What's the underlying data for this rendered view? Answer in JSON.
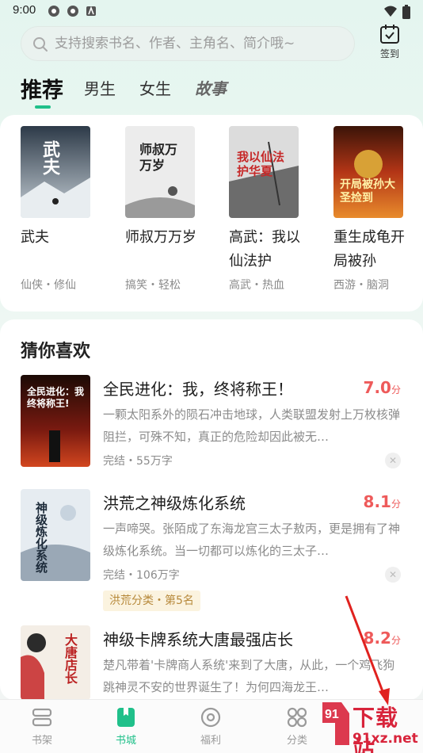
{
  "status_bar": {
    "time": "9:00"
  },
  "search": {
    "placeholder": "支持搜索书名、作者、主角名、简介哦~"
  },
  "signin": {
    "label": "签到"
  },
  "tabs": [
    {
      "label": "推荐"
    },
    {
      "label": "男生"
    },
    {
      "label": "女生"
    },
    {
      "label": "故事"
    }
  ],
  "recommend": {
    "books": [
      {
        "title": "武夫",
        "tags": "仙侠・修仙",
        "cover_text": "武夫",
        "cover_bg": "#cfd5da"
      },
      {
        "title": "师叔万万岁",
        "tags": "搞笑・轻松",
        "cover_text": "师叔万万岁",
        "cover_bg": "#e8e8e8"
      },
      {
        "title": "高武：我以仙法护",
        "tags": "高武・热血",
        "cover_text": "我以仙法护华夏",
        "cover_bg": "#d9d9d9"
      },
      {
        "title": "重生成龟开局被孙",
        "tags": "西游・脑洞",
        "cover_text": "开局被孙大圣捡到",
        "cover_bg": "#8a2b17"
      }
    ]
  },
  "guess": {
    "title": "猜你喜欢",
    "items": [
      {
        "name": "全民进化：我，终将称王！",
        "score": "7.0",
        "unit": "分",
        "desc": "一颗太阳系外的陨石冲击地球，人类联盟发射上万枚核弹阻拦，可殊不知，真正的危险却因此被无…",
        "meta": "完结・55万字",
        "badge": "",
        "cover_text": "全民进化：我终将称王!"
      },
      {
        "name": "洪荒之神级炼化系统",
        "score": "8.1",
        "unit": "分",
        "desc": "一声啼哭。张陌成了东海龙宫三太子敖丙，更是拥有了神级炼化系统。当一切都可以炼化的三太子…",
        "meta": "完结・106万字",
        "badge": "洪荒分类・第5名",
        "cover_text": "神级炼化系统"
      },
      {
        "name": "神级卡牌系统大唐最强店长",
        "score": "8.2",
        "unit": "分",
        "desc": "楚凡带着'卡牌商人系统'来到了大唐，从此，一个鸡飞狗跳神灵不安的世界诞生了！为何四海龙王…",
        "meta": "",
        "badge": "",
        "cover_text": "大唐店长"
      }
    ],
    "close_glyph": "✕"
  },
  "bottom_nav": [
    {
      "label": "书架",
      "icon": "bookshelf-icon"
    },
    {
      "label": "书城",
      "icon": "bookstore-icon"
    },
    {
      "label": "福利",
      "icon": "welfare-icon"
    },
    {
      "label": "分类",
      "icon": "category-icon"
    }
  ],
  "watermark": {
    "line1": "下载站",
    "line2": "91xz.net"
  },
  "colors": {
    "accent": "#20c08a",
    "score": "#ee5a5a",
    "badge_bg": "#fbf3df",
    "badge_text": "#b7893b"
  }
}
